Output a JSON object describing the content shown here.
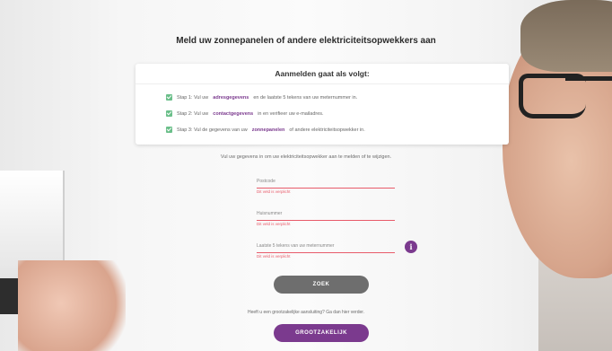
{
  "header": {
    "title": "Meld uw zonnepanelen of andere elektriciteitsopwekkers aan"
  },
  "instructions": {
    "heading": "Aanmelden gaat als volgt:",
    "steps": [
      {
        "prefix": "Stap 1: Vul uw",
        "link": "adresgegevens",
        "suffix": "en de laatste 5 tekens van uw meternummer in."
      },
      {
        "prefix": "Stap 2: Vul uw",
        "link": "contactgegevens",
        "suffix": "in en verifieer uw e-mailadres."
      },
      {
        "prefix": "Stap 3: Vul de gegevens van uw",
        "link": "zonnepanelen",
        "suffix": "of andere elektriciteitsopwekker in."
      }
    ]
  },
  "form": {
    "intro": "Vul uw gegevens in om uw elektriciteitsopwekker aan te melden of te wijzigen.",
    "fields": [
      {
        "placeholder": "Postcode",
        "error": "Dit veld is verplicht"
      },
      {
        "placeholder": "Huisnummer",
        "error": "Dit veld is verplicht"
      },
      {
        "placeholder": "Laatste 5 tekens van uw meternummer",
        "error": "Dit veld is verplicht"
      }
    ],
    "info_glyph": "i",
    "search_button": "ZOEK",
    "business_question": "Heeft u een grootzakelijke aansluiting? Ga dan hier verder.",
    "business_button": "GROOTZAKELIJK"
  },
  "colors": {
    "accent": "#7b3a8e",
    "error": "#e85b6a",
    "check": "#6bbf8a",
    "button_gray": "#6e6e6e"
  }
}
